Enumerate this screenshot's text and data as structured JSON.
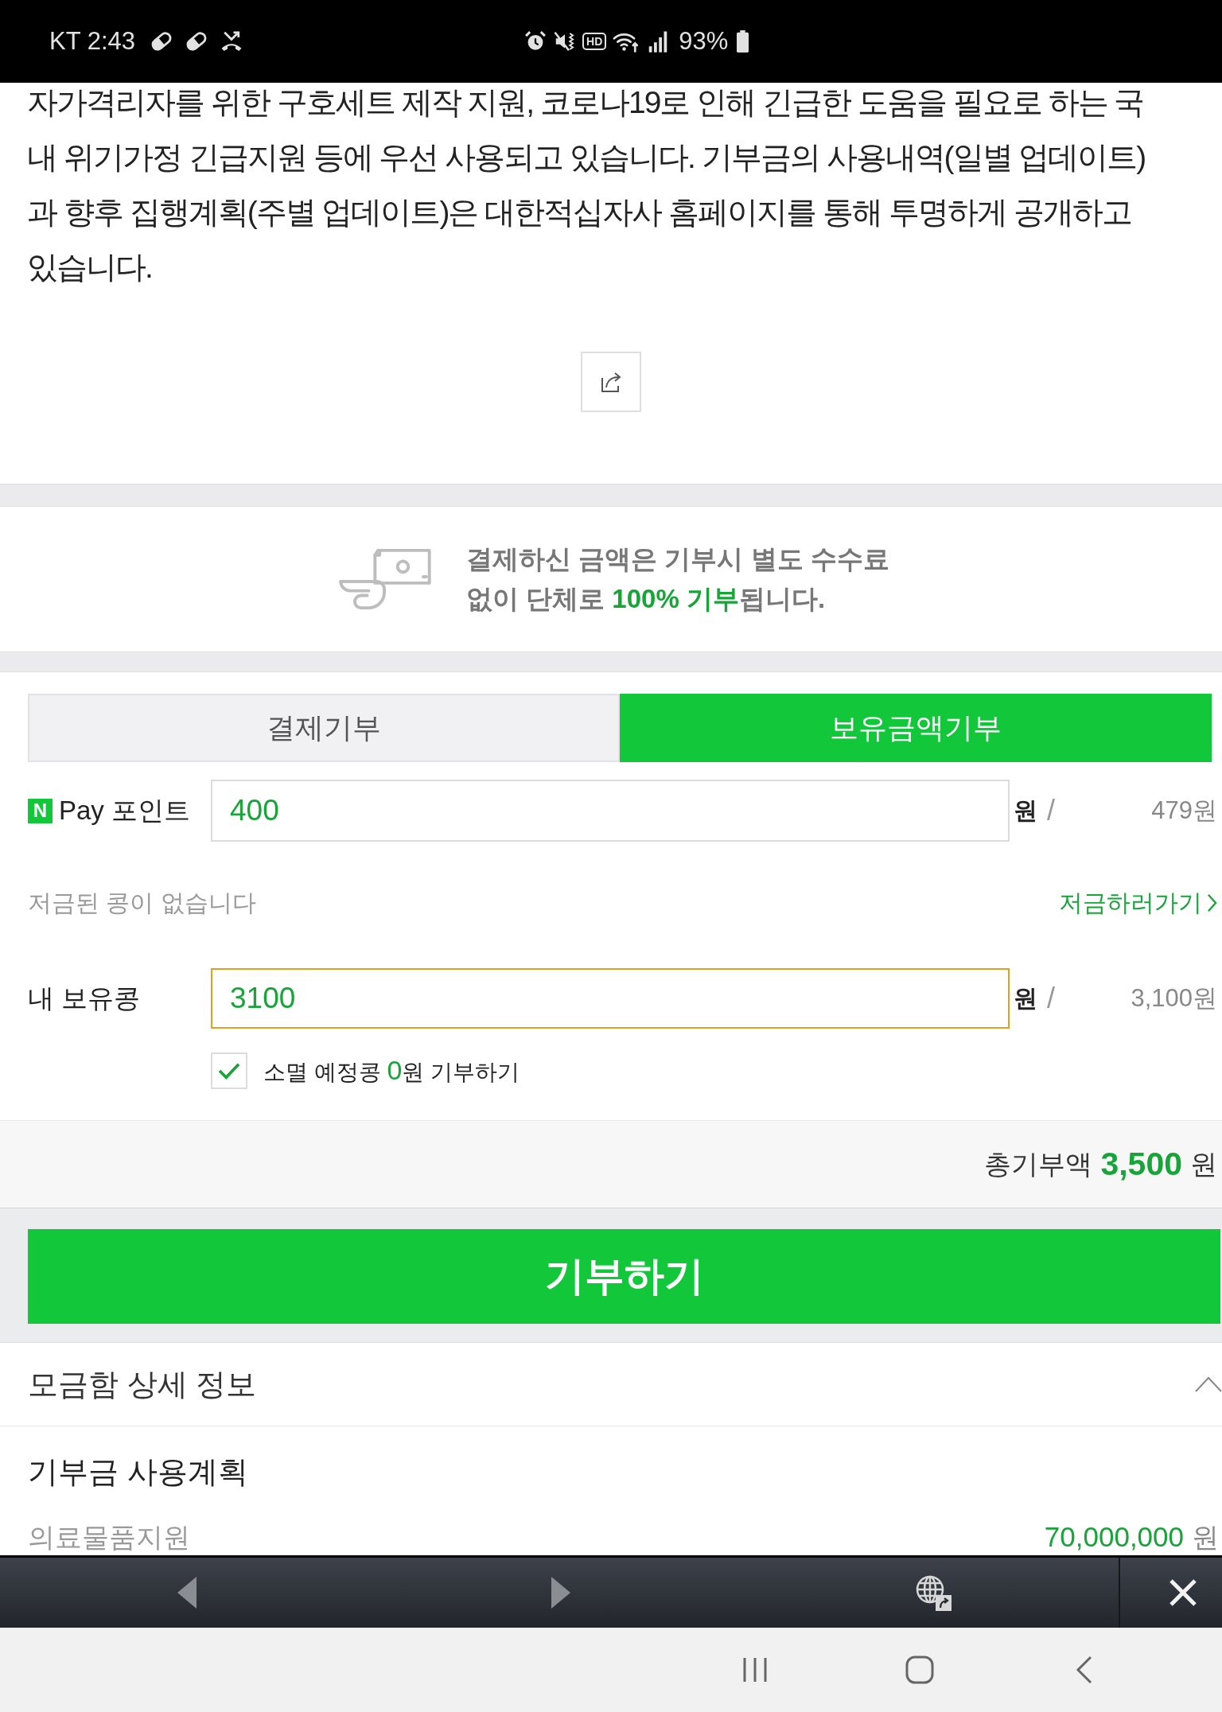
{
  "status_bar": {
    "time": "KT 2:43",
    "hd_badge": "HD",
    "battery": "93%"
  },
  "article": {
    "paragraph": "자가격리자를 위한 구호세트 제작 지원, 코로나19로 인해 긴급한 도움을 필요로 하는 국내 위기가정 긴급지원 등에 우선 사용되고 있습니다. 기부금의 사용내역(일별 업데이트)과 향후 집행계획(주별 업데이트)은 대한적십자사 홈페이지를 통해 투명하게 공개하고 있습니다."
  },
  "notice": {
    "text": "결제하신 금액은 기부시 별도 수수료 없이 단체로 **100% 기부**됩니다."
  },
  "tabs": [
    {
      "label": "결제기부",
      "selected": false
    },
    {
      "label": "보유금액기부",
      "selected": true
    }
  ],
  "pay_point": {
    "logo": "N",
    "label": "Pay 포인트",
    "value": "400",
    "focused": false,
    "unit": "원",
    "separator": "/",
    "balance": "479원"
  },
  "beans_notice": {
    "text": "저금된 콩이 없습니다",
    "link": "저금하러가기"
  },
  "my_beans": {
    "label": "내 보유콩",
    "value": "3100",
    "focused": true,
    "unit": "원",
    "separator": "/",
    "balance": "3,100원"
  },
  "expiring_beans": {
    "checked": true,
    "text": "소멸 예정콩 **0**원 기부하기"
  },
  "total": {
    "label": "총기부액",
    "amount": "3,500",
    "unit": "원"
  },
  "donate_button": {
    "label": "기부하기"
  },
  "details": {
    "title": "모금함 상세 정보",
    "expanded": true,
    "plan_title": "기부금 사용계획",
    "items": [
      {
        "name": "의료물품지원",
        "amount": "70,000,000",
        "unit": "원"
      }
    ]
  }
}
